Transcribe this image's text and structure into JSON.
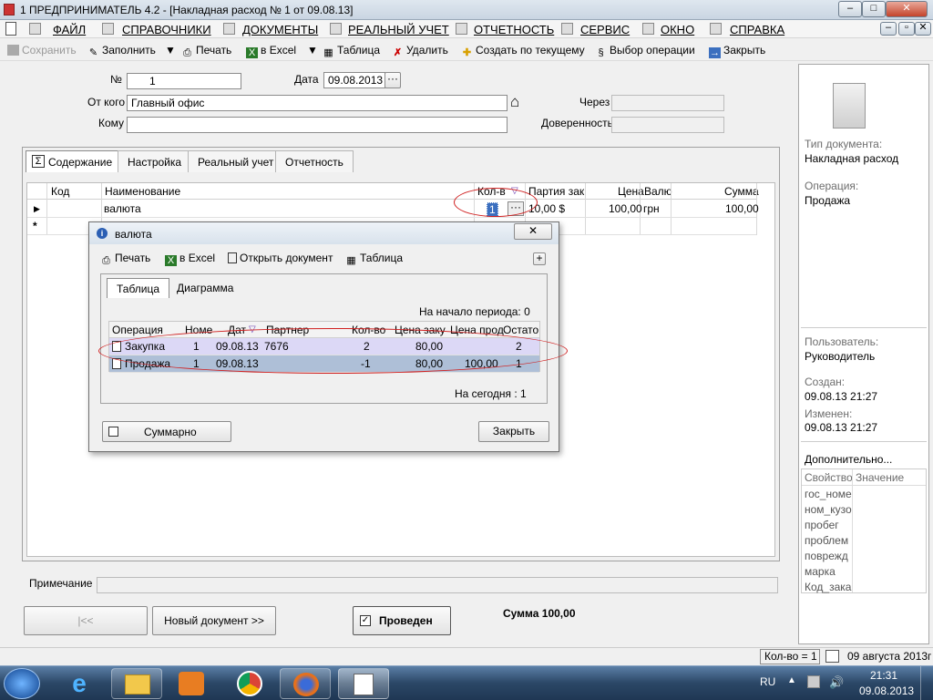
{
  "window": {
    "title": "1  ПРЕДПРИНИМАТЕЛЬ 4.2 - [Накладная расход № 1 от 09.08.13]",
    "minimize": "–",
    "maximize": "□",
    "close": "✕"
  },
  "menu": {
    "items": [
      "ФАЙЛ",
      "СПРАВОЧНИКИ",
      "ДОКУМЕНТЫ",
      "РЕАЛЬНЫЙ УЧЕТ",
      "ОТЧЕТНОСТЬ",
      "СЕРВИС",
      "ОКНО",
      "СПРАВКА"
    ]
  },
  "toolbar": {
    "save": "Сохранить",
    "fill": "Заполнить",
    "print": "Печать",
    "excel": "в Excel",
    "table": "Таблица",
    "delete": "Удалить",
    "create_current": "Создать по текущему",
    "select_op": "Выбор операции",
    "close": "Закрыть"
  },
  "form": {
    "number_label": "№",
    "number_value": "1",
    "date_label": "Дата",
    "date_value": "09.08.2013",
    "from_label": "От кого",
    "from_value": "Главный офис",
    "to_label": "Кому",
    "to_value": "",
    "via_label": "Через",
    "proxy_label": "Доверенность"
  },
  "tabs": [
    "Содержание",
    "Настройка",
    "Реальный учет",
    "Отчетность"
  ],
  "grid": {
    "headers": [
      "Код",
      "Наименование",
      "Кол-в",
      "Партия зак",
      "Цена",
      "Валю",
      "Сумма"
    ],
    "row": {
      "code": "",
      "name": "валюта",
      "qty": "1",
      "party": "10,00 $",
      "price": "100,00",
      "currency": "грн",
      "sum": "100,00"
    },
    "new_row_marker": "*"
  },
  "dialog": {
    "title": "валюта",
    "print": "Печать",
    "excel": "в Excel",
    "open_doc": "Открыть документ",
    "table": "Таблица",
    "tabs": [
      "Таблица",
      "Диаграмма"
    ],
    "period_start": "На начало периода:  0",
    "headers": [
      "Операция",
      "Номе",
      "Дат",
      "Партнер",
      "Кол-во",
      "Цена заку",
      "Цена прод",
      "Остато"
    ],
    "rows": [
      {
        "op": "Закупка",
        "num": "1",
        "date": "09.08.13",
        "partner": "7676",
        "qty": "2",
        "buy": "80,00",
        "sell": "",
        "rest": "2"
      },
      {
        "op": "Продажа",
        "num": "1",
        "date": "09.08.13",
        "partner": "",
        "qty": "-1",
        "buy": "80,00",
        "sell": "100,00",
        "rest": "1"
      }
    ],
    "today": "На сегодня :  1",
    "summary": "Суммарно",
    "close": "Закрыть"
  },
  "bottom": {
    "note_label": "Примечание",
    "first": "|<<",
    "new_doc": "Новый документ >>",
    "posted": "Проведен",
    "sum_label": "Сумма  100,00"
  },
  "sidebar": {
    "doc_type_label": "Тип документа:",
    "doc_type": "Накладная расход",
    "op_label": "Операция:",
    "op": "Продажа",
    "user_label": "Пользователь:",
    "user": "Руководитель",
    "created_label": "Создан:",
    "created": "09.08.13  21:27",
    "changed_label": "Изменен:",
    "changed": "09.08.13  21:27",
    "extra": "Дополнительно...",
    "prop_header": "Свойство",
    "val_header": "Значение",
    "props": [
      "гос_номе",
      "ном_кузо",
      "пробег",
      "проблем",
      "поврежд",
      "марка",
      "Код_зака"
    ]
  },
  "status": {
    "qty": "Кол-во = 1",
    "date": "09 августа 2013г"
  },
  "taskbar": {
    "lang": "RU",
    "time": "21:31",
    "date": "09.08.2013"
  }
}
